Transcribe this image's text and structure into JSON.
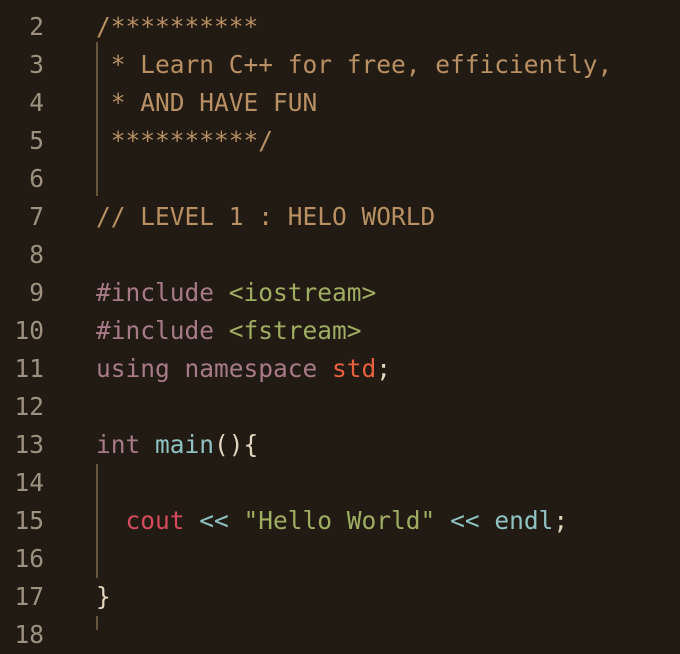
{
  "editor": {
    "lines": [
      {
        "num": "2",
        "tokens": [
          {
            "text": "/**********",
            "kind": "comment"
          }
        ]
      },
      {
        "num": "3",
        "tokens": [
          {
            "text": " * Learn C++ for free, efficiently,",
            "kind": "comment"
          }
        ]
      },
      {
        "num": "4",
        "tokens": [
          {
            "text": " * AND HAVE FUN",
            "kind": "comment"
          }
        ]
      },
      {
        "num": "5",
        "tokens": [
          {
            "text": " **********/",
            "kind": "comment"
          }
        ]
      },
      {
        "num": "6",
        "tokens": []
      },
      {
        "num": "7",
        "tokens": [
          {
            "text": "// LEVEL 1 : HELO WORLD",
            "kind": "comment"
          }
        ]
      },
      {
        "num": "8",
        "tokens": []
      },
      {
        "num": "9",
        "tokens": [
          {
            "text": "#include ",
            "kind": "preproc"
          },
          {
            "text": "<iostream>",
            "kind": "string"
          }
        ]
      },
      {
        "num": "10",
        "tokens": [
          {
            "text": "#include ",
            "kind": "preproc"
          },
          {
            "text": "<fstream>",
            "kind": "string"
          }
        ]
      },
      {
        "num": "11",
        "tokens": [
          {
            "text": "using namespace ",
            "kind": "keyword"
          },
          {
            "text": "std",
            "kind": "ident-std"
          },
          {
            "text": ";",
            "kind": "punct"
          }
        ]
      },
      {
        "num": "12",
        "tokens": []
      },
      {
        "num": "13",
        "tokens": [
          {
            "text": "int ",
            "kind": "keyword"
          },
          {
            "text": "main",
            "kind": "func"
          },
          {
            "text": "(){",
            "kind": "punct"
          }
        ]
      },
      {
        "num": "14",
        "tokens": []
      },
      {
        "num": "15",
        "tokens": [
          {
            "text": "  ",
            "kind": "punct"
          },
          {
            "text": "cout",
            "kind": "cout"
          },
          {
            "text": " << ",
            "kind": "op"
          },
          {
            "text": "\"Hello World\"",
            "kind": "string"
          },
          {
            "text": " << ",
            "kind": "op"
          },
          {
            "text": "endl",
            "kind": "endl"
          },
          {
            "text": ";",
            "kind": "punct"
          }
        ]
      },
      {
        "num": "16",
        "tokens": []
      },
      {
        "num": "17",
        "tokens": [
          {
            "text": "}",
            "kind": "punct"
          }
        ]
      },
      {
        "num": "18",
        "tokens": []
      }
    ]
  }
}
